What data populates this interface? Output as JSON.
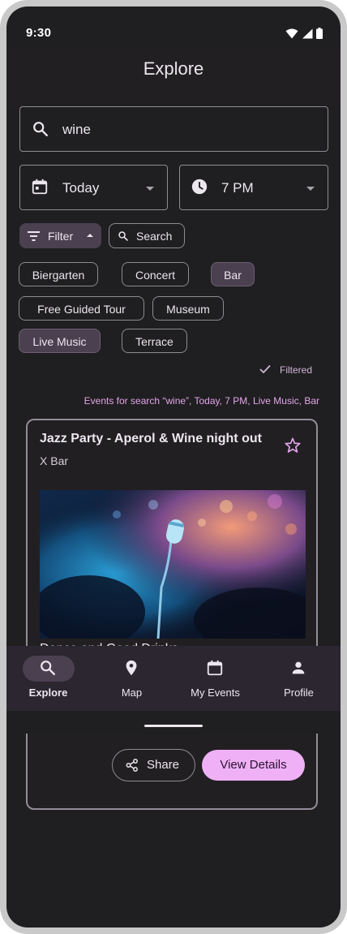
{
  "status_bar": {
    "time": "9:30"
  },
  "app_bar": {
    "title": "Explore"
  },
  "search": {
    "value": "wine",
    "icon": "search-icon"
  },
  "date_dropdown": {
    "value": "Today",
    "icon": "calendar-icon"
  },
  "time_dropdown": {
    "value": "7 PM",
    "icon": "clock-icon"
  },
  "filter_button": {
    "label": "Filter"
  },
  "search_button": {
    "label": "Search"
  },
  "chips": [
    {
      "label": "Biergarten",
      "selected": false
    },
    {
      "label": "Concert",
      "selected": false
    },
    {
      "label": "Bar",
      "selected": true
    },
    {
      "label": "Free Guided Tour",
      "selected": false
    },
    {
      "label": "Museum",
      "selected": false
    },
    {
      "label": "Live Music",
      "selected": true
    },
    {
      "label": "Terrace",
      "selected": false
    }
  ],
  "filtered": {
    "label": "Filtered"
  },
  "summary": "Events for search “wine”, Today, 7 PM, Live Music, Bar",
  "event_card": {
    "title": "Jazz Party - Aperol & Wine night out",
    "venue": "X Bar",
    "description": "Dance and Good Drinks",
    "share_label": "Share",
    "details_label": "View Details"
  },
  "bottom_nav": [
    {
      "label": "Explore",
      "icon": "search-icon",
      "active": true
    },
    {
      "label": "Map",
      "icon": "map-pin-icon",
      "active": false
    },
    {
      "label": "My Events",
      "icon": "calendar-icon",
      "active": false
    },
    {
      "label": "Profile",
      "icon": "person-icon",
      "active": false
    }
  ],
  "colors": {
    "accent": "#efb0f6",
    "background": "#1f1e20",
    "chip_selected": "#4a4050"
  }
}
